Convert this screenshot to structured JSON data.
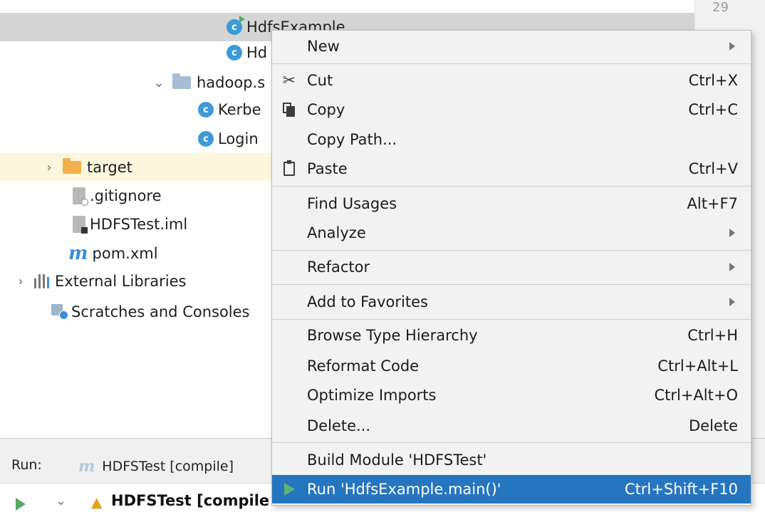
{
  "tree": {
    "line_number": "29",
    "items": [
      {
        "label": "HdfsExample"
      },
      {
        "label": "Hd"
      },
      {
        "label": "hadoop.s"
      },
      {
        "label": "Kerbe"
      },
      {
        "label": "Login"
      },
      {
        "label": "target"
      },
      {
        "label": ".gitignore"
      },
      {
        "label": "HDFSTest.iml"
      },
      {
        "label": "pom.xml"
      },
      {
        "label": "External Libraries"
      },
      {
        "label": "Scratches and Consoles"
      }
    ]
  },
  "menu": {
    "items": [
      {
        "label": "New",
        "shortcut": "",
        "submenu": true
      },
      {
        "label": "Cut",
        "shortcut": "Ctrl+X",
        "icon": "scissors-icon"
      },
      {
        "label": "Copy",
        "shortcut": "Ctrl+C",
        "icon": "copy-icon"
      },
      {
        "label": "Copy Path...",
        "shortcut": ""
      },
      {
        "label": "Paste",
        "shortcut": "Ctrl+V",
        "icon": "paste-icon"
      },
      {
        "label": "Find Usages",
        "shortcut": "Alt+F7"
      },
      {
        "label": "Analyze",
        "shortcut": "",
        "submenu": true
      },
      {
        "label": "Refactor",
        "shortcut": "",
        "submenu": true
      },
      {
        "label": "Add to Favorites",
        "shortcut": "",
        "submenu": true
      },
      {
        "label": "Browse Type Hierarchy",
        "shortcut": "Ctrl+H"
      },
      {
        "label": "Reformat Code",
        "shortcut": "Ctrl+Alt+L"
      },
      {
        "label": "Optimize Imports",
        "shortcut": "Ctrl+Alt+O"
      },
      {
        "label": "Delete...",
        "shortcut": "Delete"
      },
      {
        "label": "Build Module 'HDFSTest'",
        "shortcut": ""
      },
      {
        "label": "Run 'HdfsExample.main()'",
        "shortcut": "Ctrl+Shift+F10",
        "icon": "run-icon",
        "active": true
      }
    ]
  },
  "run_panel": {
    "label": "Run:",
    "tab": "HDFSTest [compile]",
    "build_text": "HDFSTest [compile"
  },
  "colors": {
    "menu_highlight": "#2675bf",
    "selection_row": "#d5d5d5",
    "class_icon": "#3d9ad8",
    "run_green": "#59a869"
  }
}
